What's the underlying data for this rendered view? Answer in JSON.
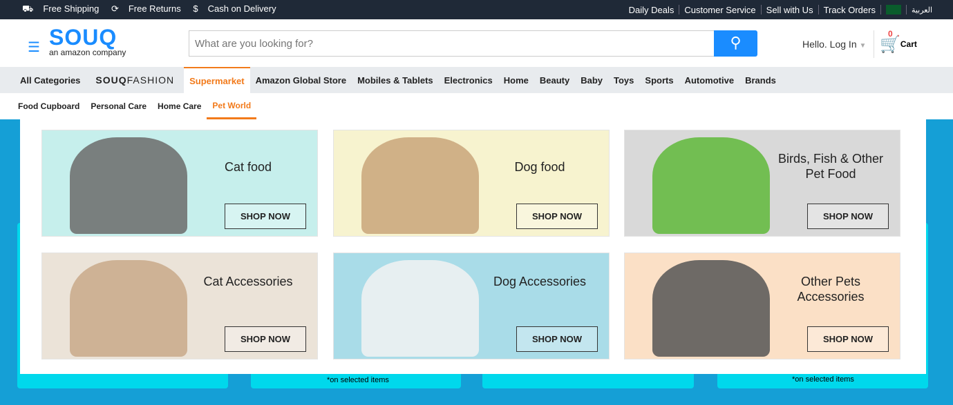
{
  "topbar": {
    "left": [
      "Free Shipping",
      "Free Returns",
      "Cash on Delivery"
    ],
    "left_icons": [
      "truck-icon",
      "refresh-icon",
      "dollar-icon"
    ],
    "right": [
      "Daily Deals",
      "Customer Service",
      "Sell with Us",
      "Track Orders"
    ],
    "language": "العربية"
  },
  "header": {
    "logo": "SOUQ",
    "tagline": "an amazon company",
    "search_placeholder": "What are you looking for?",
    "login": "Hello. Log In",
    "cart_label": "Cart",
    "cart_count": "0"
  },
  "nav": {
    "items": [
      "All Categories",
      "Supermarket",
      "Amazon Global Store",
      "Mobiles & Tablets",
      "Electronics",
      "Home",
      "Beauty",
      "Baby",
      "Toys",
      "Sports",
      "Automotive",
      "Brands"
    ],
    "fashion_a": "SOUQ",
    "fashion_b": "FASHION",
    "active": "Supermarket"
  },
  "subnav": {
    "items": [
      "Food Cupboard",
      "Personal Care",
      "Home Care",
      "Pet World"
    ],
    "active": "Pet World"
  },
  "tiles": [
    {
      "title": "Cat food",
      "button": "SHOP NOW",
      "bg": "#c6efec"
    },
    {
      "title": "Dog food",
      "button": "SHOP NOW",
      "bg": "#f7f3cf"
    },
    {
      "title": "Birds, Fish & Other Pet Food",
      "button": "SHOP NOW",
      "bg": "#d9d9d9"
    },
    {
      "title": "Cat Accessories",
      "button": "SHOP NOW",
      "bg": "#ebe3d8"
    },
    {
      "title": "Dog Accessories",
      "button": "SHOP NOW",
      "bg": "#a9dce8"
    },
    {
      "title": "Other Pets Accessories",
      "button": "SHOP NOW",
      "bg": "#fbe0c6"
    }
  ],
  "promos": {
    "note1": "*on selected items",
    "note2": "*on selected items"
  },
  "colors": {
    "accent": "#f27a1a",
    "brand": "#1a8cff",
    "topbar": "#1f2937",
    "page_bg": "#159fd6"
  }
}
